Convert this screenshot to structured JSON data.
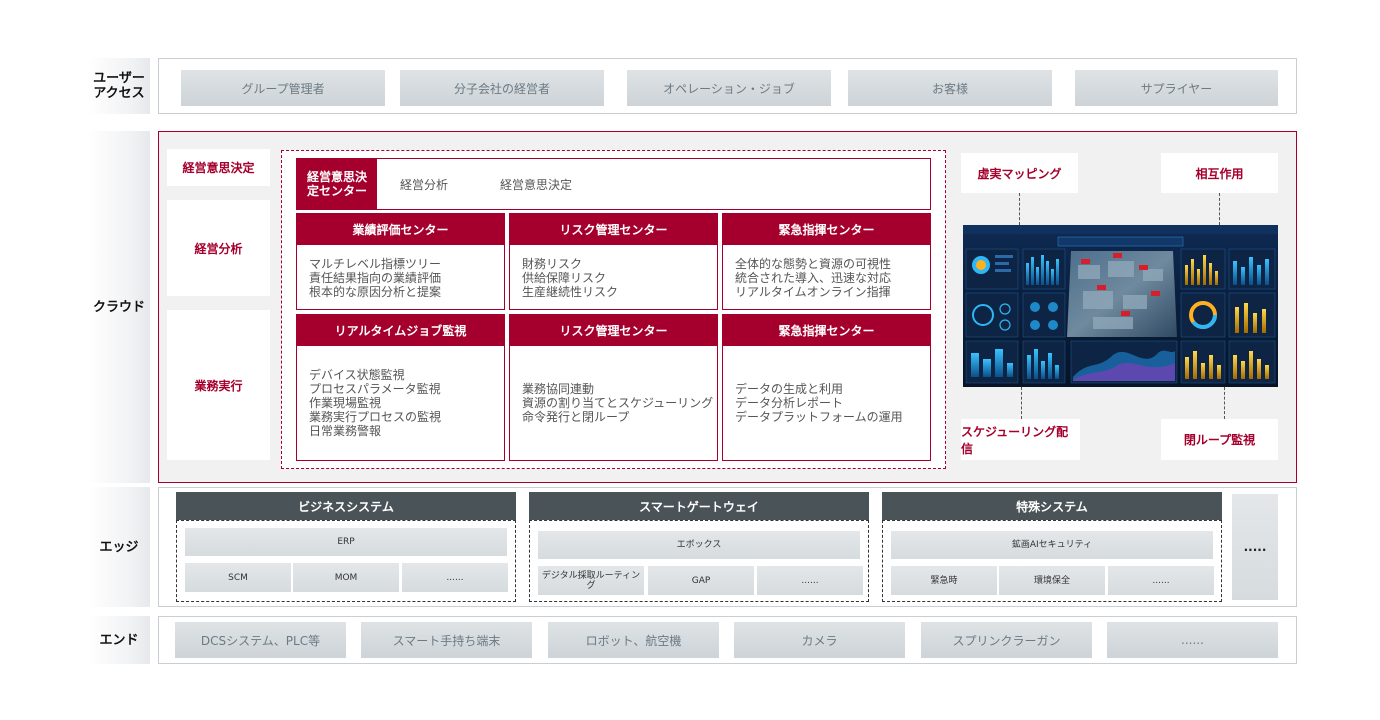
{
  "layers": {
    "user_access": "ユーザー\nアクセス",
    "cloud": "クラウド",
    "edge": "エッジ",
    "end": "エンド"
  },
  "user_access": {
    "items": [
      "グループ管理者",
      "分子会社の経営者",
      "オペレーション・ジョブ",
      "お客様",
      "サプライヤー"
    ]
  },
  "cloud": {
    "left_cards": [
      "経営意思決定",
      "経営分析",
      "業務実行"
    ],
    "topbar": {
      "active": "経営意思決定センター",
      "tabs": [
        "経営分析",
        "経営意思決定"
      ]
    },
    "cards": [
      {
        "title": "業績評価センター",
        "lines": [
          "マルチレベル指標ツリー",
          "責任結果指向の業績評価",
          "根本的な原因分析と提案"
        ]
      },
      {
        "title": "リスク管理センター",
        "lines": [
          "財務リスク",
          "供給保障リスク",
          "生産継続性リスク"
        ]
      },
      {
        "title": "緊急指揮センター",
        "lines": [
          "全体的な態勢と資源の可視性",
          "統合された導入、迅速な対応",
          "リアルタイムオンライン指揮"
        ]
      },
      {
        "title": "リアルタイムジョブ監視",
        "lines": [
          "デバイス状態監視",
          "プロセスパラメータ監視",
          "作業現場監視",
          "業務実行プロセスの監視",
          "日常業務警報"
        ]
      },
      {
        "title": "リスク管理センター",
        "lines": [
          "業務協同連動",
          "資源の割り当てとスケジューリング",
          "命令発行と閉ループ"
        ]
      },
      {
        "title": "緊急指揮センター",
        "lines": [
          "データの生成と利用",
          "データ分析レポート",
          "データプラットフォームの運用"
        ]
      }
    ],
    "right_cards": [
      "虚実マッピング",
      "相互作用",
      "スケジューリング配信",
      "閉ループ監視"
    ]
  },
  "edge": {
    "groups": [
      {
        "title": "ビジネスシステム",
        "top": "ERP",
        "bottom": [
          "SCM",
          "MOM",
          "......"
        ]
      },
      {
        "title": "スマートゲートウェイ",
        "top": "エボックス",
        "bottom": [
          "デジタル採取ルーティング",
          "GAP",
          "......"
        ]
      },
      {
        "title": "特殊システム",
        "top": "鉱画AIセキュリティ",
        "bottom": [
          "緊急時",
          "環境保全",
          "......"
        ]
      }
    ],
    "more": "....."
  },
  "end": {
    "items": [
      "DCSシステム、PLC等",
      "スマート手持ち端末",
      "ロボット、航空機",
      "カメラ",
      "スプリンクラーガン",
      "......"
    ]
  },
  "colors": {
    "accent": "#a5002d",
    "edge_header": "#4a5358",
    "button": "#d3d8dc"
  }
}
